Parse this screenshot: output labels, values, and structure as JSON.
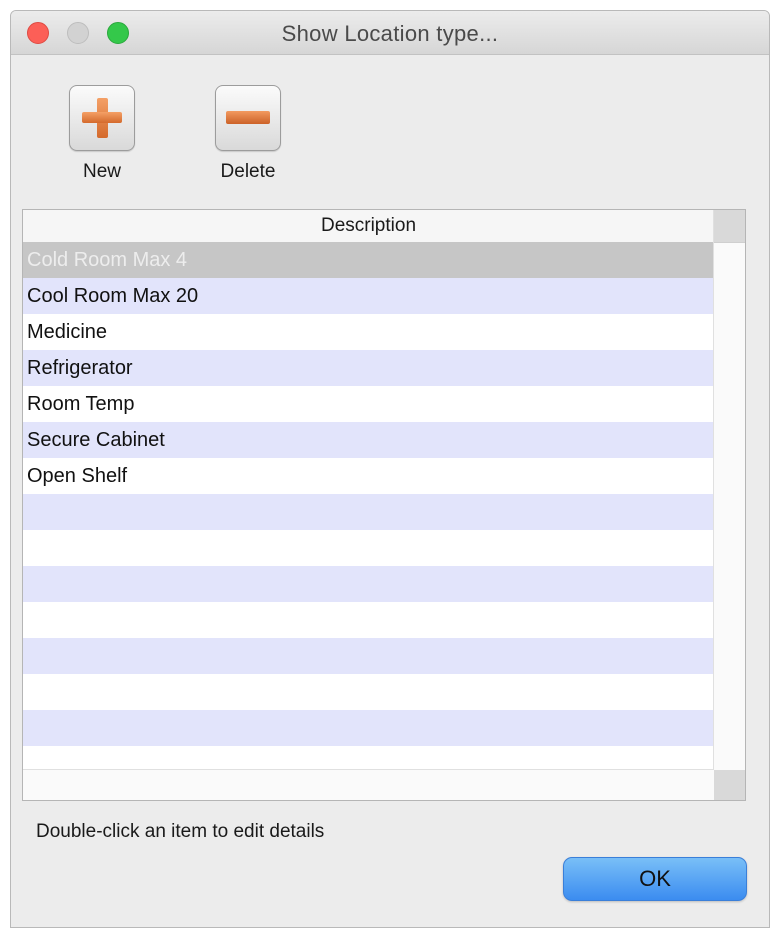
{
  "window": {
    "title": "Show Location type..."
  },
  "toolbar": {
    "new_label": "New",
    "delete_label": "Delete"
  },
  "table": {
    "column_header": "Description",
    "rows": [
      "Cold Room Max 4",
      "Cool Room Max 20",
      "Medicine",
      "Refrigerator",
      "Room Temp",
      "Secure Cabinet",
      "Open Shelf",
      "",
      "",
      "",
      "",
      "",
      "",
      "",
      ""
    ],
    "selected_index": 0
  },
  "footer": {
    "hint": "Double-click an item to edit details",
    "ok_label": "OK"
  },
  "colors": {
    "stripe": "#e2e4fb",
    "selected_row": "#c6c6c6",
    "ok_button": "#3b8cf0",
    "icon_orange": "#d46a2c"
  }
}
